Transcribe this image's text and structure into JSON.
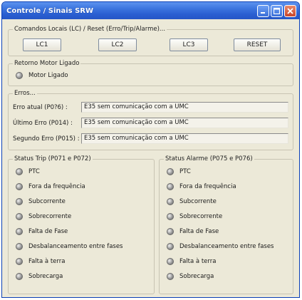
{
  "window": {
    "title": "Controle / Sinais SRW"
  },
  "local_commands": {
    "legend": "Comandos Locais (LC) / Reset (Erro/Trip/Alarme)...",
    "buttons": [
      "LC1",
      "LC2",
      "LC3",
      "RESET"
    ]
  },
  "motor_feedback": {
    "legend": "Retorno Motor Ligado",
    "item": "Motor Ligado"
  },
  "errors": {
    "legend": "Erros...",
    "rows": [
      {
        "label": "Erro atual (P0?6) :",
        "value": "E35 sem comunicação com a UMC"
      },
      {
        "label": "Último Erro (P014) :",
        "value": "E35 sem comunicação com a UMC"
      },
      {
        "label": "Segundo Erro (P015) :",
        "value": "E35 sem comunicação com a UMC"
      }
    ]
  },
  "status_trip": {
    "legend": "Status Trip (P071 e P072)",
    "items": [
      "PTC",
      "Fora da frequência",
      "Subcorrente",
      "Sobrecorrente",
      "Falta de Fase",
      "Desbalanceamento entre fases",
      "Falta à terra",
      "Sobrecarga"
    ]
  },
  "status_alarm": {
    "legend": "Status Alarme (P075 e P076)",
    "items": [
      "PTC",
      "Fora da frequência",
      "Subcorrente",
      "Sobrecorrente",
      "Falta de Fase",
      "Desbalanceamento entre fases",
      "Falta à terra",
      "Sobrecarga"
    ]
  },
  "colors": {
    "titlebar": "#2a5fd2",
    "window_bg": "#ece9d8",
    "close_button": "#c9452a"
  }
}
